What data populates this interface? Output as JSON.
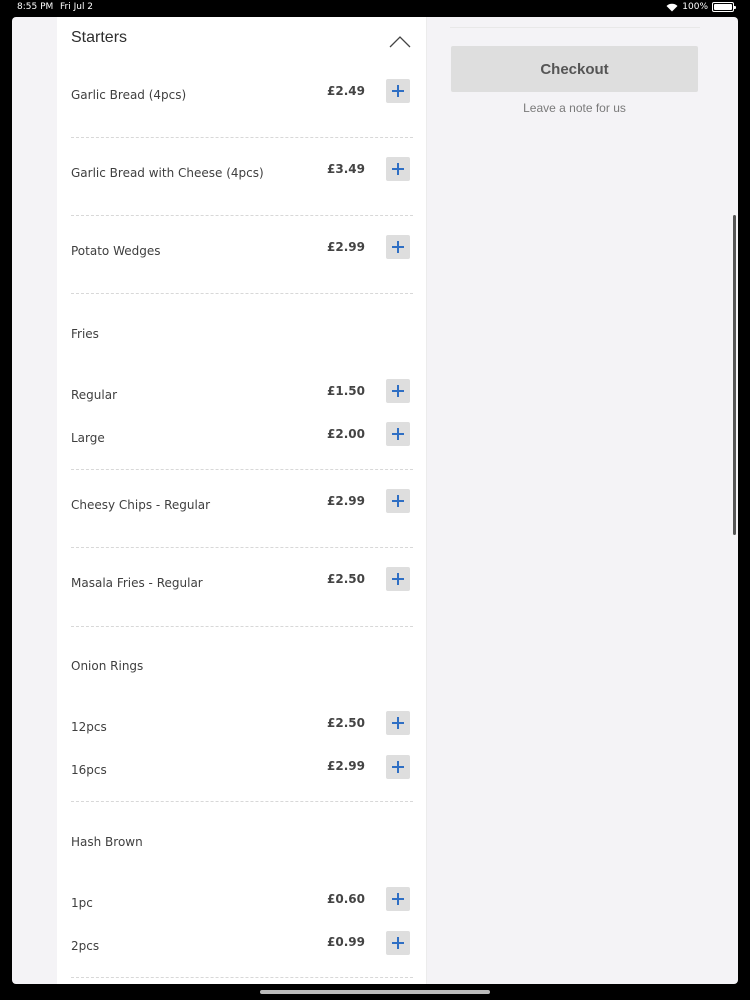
{
  "status_bar": {
    "time": "8:55 PM",
    "date": "Fri Jul 2",
    "battery": "100%"
  },
  "menu": {
    "section_title": "Starters",
    "items": [
      {
        "name": "Garlic Bread (4pcs)",
        "price": "£2.49"
      },
      {
        "name": "Garlic Bread with Cheese (4pcs)",
        "price": "£3.49"
      },
      {
        "name": "Potato Wedges",
        "price": "£2.99"
      }
    ],
    "fries": {
      "label": "Fries",
      "options": [
        {
          "name": "Regular",
          "price": "£1.50"
        },
        {
          "name": "Large",
          "price": "£2.00"
        }
      ]
    },
    "items2": [
      {
        "name": "Cheesy Chips - Regular",
        "price": "£2.99"
      },
      {
        "name": "Masala Fries - Regular",
        "price": "£2.50"
      }
    ],
    "onion_rings": {
      "label": "Onion Rings",
      "options": [
        {
          "name": "12pcs",
          "price": "£2.50"
        },
        {
          "name": "16pcs",
          "price": "£2.99"
        }
      ]
    },
    "hash_brown": {
      "label": "Hash Brown",
      "options": [
        {
          "name": "1pc",
          "price": "£0.60"
        },
        {
          "name": "2pcs",
          "price": "£0.99"
        }
      ]
    }
  },
  "cart": {
    "checkout_label": "Checkout",
    "note_label": "Leave a note for us"
  },
  "colors": {
    "accent": "#2f6fc4",
    "button_bg": "#dedede"
  },
  "icons": {
    "add": "plus-icon",
    "collapse": "chevron-up-icon"
  }
}
